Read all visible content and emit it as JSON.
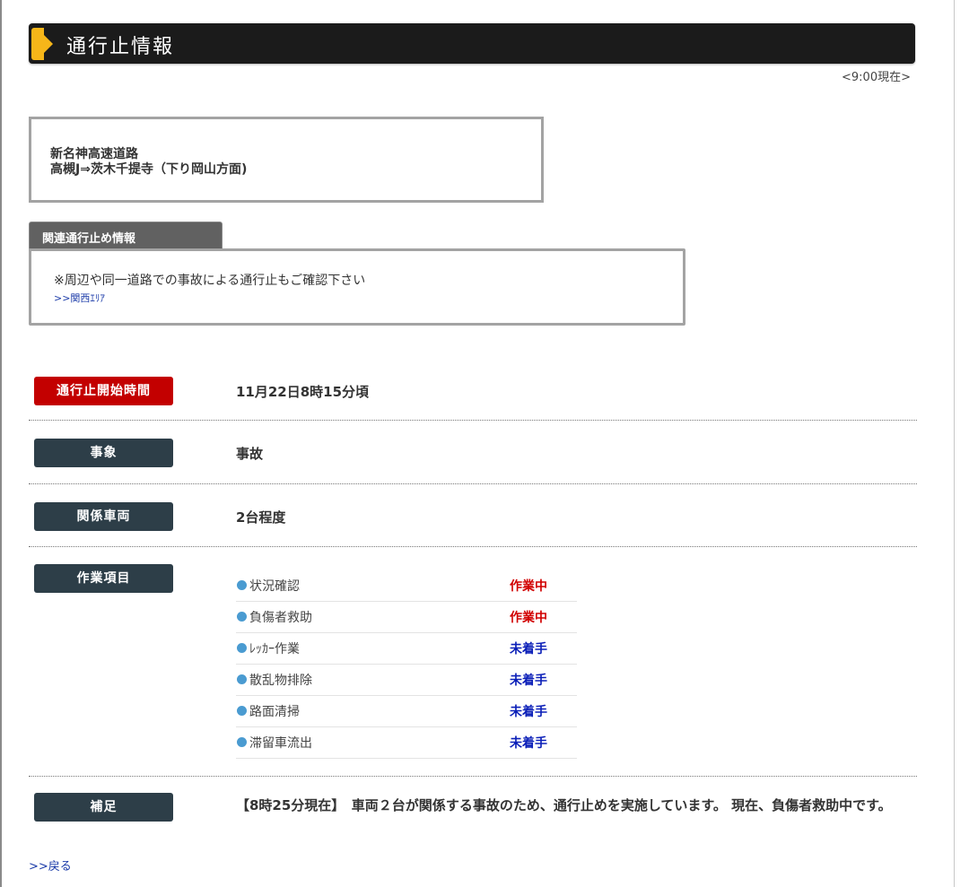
{
  "header": {
    "title": "通行止情報",
    "timestamp": "<9:00現在>"
  },
  "road": {
    "name": "新名神高速道路",
    "section": "高槻J⇒茨木千提寺（下り岡山方面)"
  },
  "related": {
    "tab_label": "関連通行止め情報",
    "note": "※周辺や同一道路での事故による通行止もご確認下さい",
    "link": ">>関西ｴﾘｱ"
  },
  "details": {
    "start_time": {
      "label": "通行止開始時間",
      "value": "11月22日8時15分頃"
    },
    "event": {
      "label": "事象",
      "value": "事故"
    },
    "vehicles": {
      "label": "関係車両",
      "value": "2台程度"
    },
    "work": {
      "label": "作業項目",
      "items": [
        {
          "name": "状況確認",
          "status": "作業中"
        },
        {
          "name": "負傷者救助",
          "status": "作業中"
        },
        {
          "name": "ﾚｯｶｰ作業",
          "status": "未着手"
        },
        {
          "name": "散乱物排除",
          "status": "未着手"
        },
        {
          "name": "路面清掃",
          "status": "未着手"
        },
        {
          "name": "滞留車流出",
          "status": "未着手"
        }
      ]
    },
    "supplement": {
      "label": "補足",
      "text": "【8時25分現在】　車両２台が関係する事故のため、通行止めを実施しています。 現在、負傷者救助中です。"
    }
  },
  "footer": {
    "back_link": ">>戻る"
  },
  "colors": {
    "title_bar": "#1b1b1b",
    "title_marker": "#f6b619",
    "badge_red": "#c30000",
    "badge_dark": "#2d3e48",
    "status_in_progress": "#d10000",
    "status_not_started": "#0b1fb8",
    "link": "#1a3aa8",
    "bullet": "#4a9bd1"
  }
}
